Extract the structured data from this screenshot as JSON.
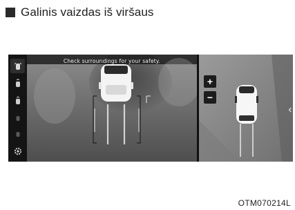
{
  "header": {
    "title": "Galinis vaizdas iš viršaus"
  },
  "screen": {
    "notice": "Check surroundings for your safety.",
    "sidebar": [
      {
        "icon": "car-view-top-icon",
        "active": true
      },
      {
        "icon": "car-view-rear-icon",
        "active": false
      },
      {
        "icon": "car-view-side-icon",
        "active": false
      },
      {
        "icon": "car-view-front-icon",
        "active": false
      },
      {
        "icon": "car-view-3d-icon",
        "active": false
      },
      {
        "icon": "gear-icon",
        "active": false
      }
    ],
    "zoom": {
      "in_label": "+",
      "out_label": "−"
    }
  },
  "figure_code": "OTM070214L"
}
